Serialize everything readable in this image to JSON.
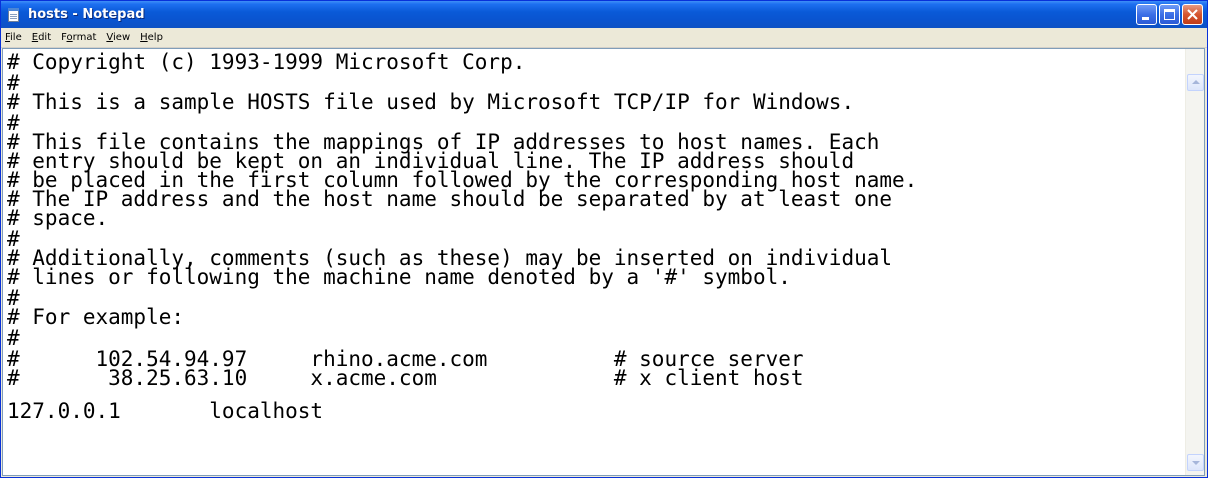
{
  "window": {
    "title": "hosts - Notepad"
  },
  "icons": {
    "app": "notepad-icon",
    "minimize": "minimize-icon",
    "maximize": "maximize-icon",
    "close": "close-icon",
    "scroll_up": "chevron-up-icon",
    "scroll_down": "chevron-down-icon"
  },
  "colors": {
    "titlebar": "#0a54d0",
    "close_button": "#d5552f",
    "chrome": "#ece9d8",
    "editor_background": "#ffffff",
    "text": "#000000"
  },
  "menu": {
    "items": [
      {
        "accel": "F",
        "rest": "ile"
      },
      {
        "accel": "E",
        "rest": "dit"
      },
      {
        "pre": "F",
        "accel": "o",
        "rest": "rmat"
      },
      {
        "accel": "V",
        "rest": "iew"
      },
      {
        "accel": "H",
        "rest": "elp"
      }
    ]
  },
  "editor": {
    "lines": [
      "# Copyright (c) 1993-1999 Microsoft Corp.",
      "#",
      "# This is a sample HOSTS file used by Microsoft TCP/IP for Windows.",
      "#",
      "# This file contains the mappings of IP addresses to host names. Each",
      "# entry should be kept on an individual line. The IP address should",
      "# be placed in the first column followed by the corresponding host name.",
      "# The IP address and the host name should be separated by at least one",
      "# space.",
      "#",
      "# Additionally, comments (such as these) may be inserted on individual",
      "# lines or following the machine name denoted by a '#' symbol.",
      "#",
      "# For example:",
      "#",
      "#      102.54.94.97     rhino.acme.com          # source server",
      "#       38.25.63.10     x.acme.com              # x client host",
      "127.0.0.1       localhost"
    ]
  }
}
